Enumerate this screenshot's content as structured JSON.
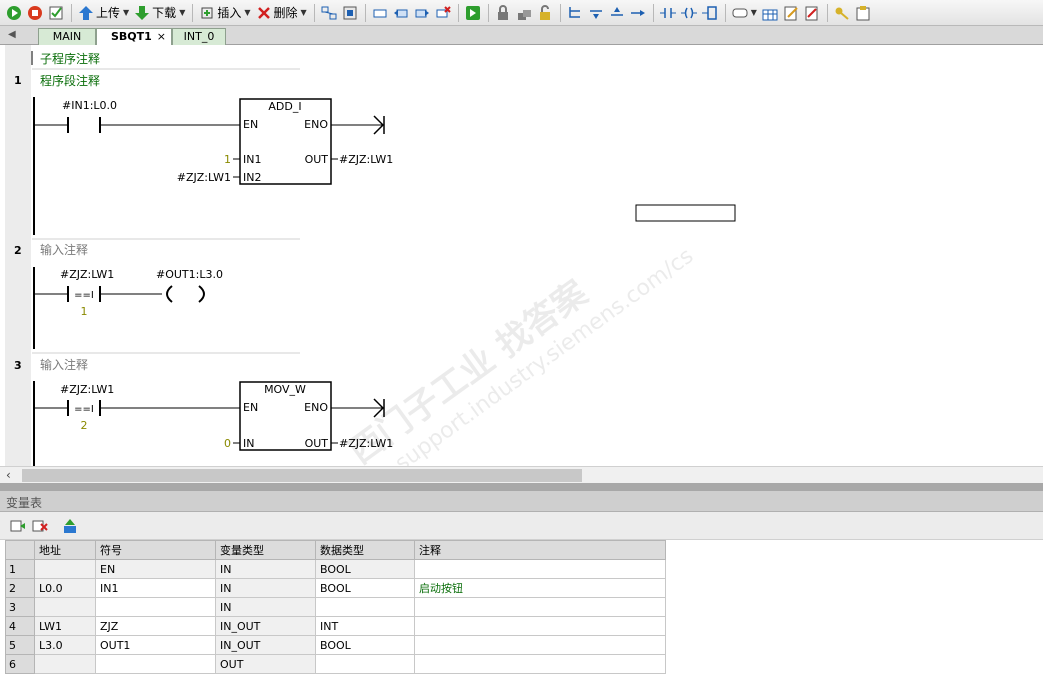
{
  "toolbar": {
    "upload_label": "上传",
    "download_label": "下载",
    "insert_label": "插入",
    "delete_label": "删除"
  },
  "tabs": [
    {
      "label": "MAIN"
    },
    {
      "label": "SBQT1",
      "active": true
    },
    {
      "label": "INT_0"
    }
  ],
  "tabs_close": "×",
  "editor": {
    "subroutine_comment": "子程序注释",
    "networks": [
      {
        "num": "1",
        "comment": "程序段注释",
        "contact_label": "#IN1:L0.0",
        "box": {
          "name": "ADD_I",
          "en": "EN",
          "eno": "ENO",
          "in1": "IN1",
          "in2": "IN2",
          "out": "OUT",
          "in1_val": "1",
          "in2_val": "#ZJZ:LW1",
          "out_val": "#ZJZ:LW1"
        }
      },
      {
        "num": "2",
        "comment": "输入注释",
        "contact_label": "#ZJZ:LW1",
        "contact_op": "==I",
        "contact_val": "1",
        "coil_label": "#OUT1:L3.0"
      },
      {
        "num": "3",
        "comment": "输入注释",
        "contact_label": "#ZJZ:LW1",
        "contact_op": "==I",
        "contact_val": "2",
        "box": {
          "name": "MOV_W",
          "en": "EN",
          "eno": "ENO",
          "in": "IN",
          "out": "OUT",
          "in_val": "0",
          "out_val": "#ZJZ:LW1"
        }
      }
    ],
    "watermark_line1": "西门子工业  找答案",
    "watermark_line2": "support.industry.siemens.com/cs"
  },
  "var_panel": {
    "title": "变量表",
    "columns": [
      "",
      "地址",
      "符号",
      "变量类型",
      "数据类型",
      "注释"
    ],
    "rows": [
      {
        "n": "1",
        "addr": "",
        "sym": "EN",
        "vtype": "IN",
        "dtype": "BOOL",
        "comment": ""
      },
      {
        "n": "2",
        "addr": "L0.0",
        "sym": "IN1",
        "vtype": "IN",
        "dtype": "BOOL",
        "comment": "启动按钮"
      },
      {
        "n": "3",
        "addr": "",
        "sym": "",
        "vtype": "IN",
        "dtype": "",
        "comment": ""
      },
      {
        "n": "4",
        "addr": "LW1",
        "sym": "ZJZ",
        "vtype": "IN_OUT",
        "dtype": "INT",
        "comment": ""
      },
      {
        "n": "5",
        "addr": "L3.0",
        "sym": "OUT1",
        "vtype": "IN_OUT",
        "dtype": "BOOL",
        "comment": ""
      },
      {
        "n": "6",
        "addr": "",
        "sym": "",
        "vtype": "OUT",
        "dtype": "",
        "comment": ""
      }
    ]
  },
  "colors": {
    "comment_green": "#0a6e0a",
    "comment_grey": "#7a7a7a",
    "tab_bg": "#d7ead5"
  }
}
